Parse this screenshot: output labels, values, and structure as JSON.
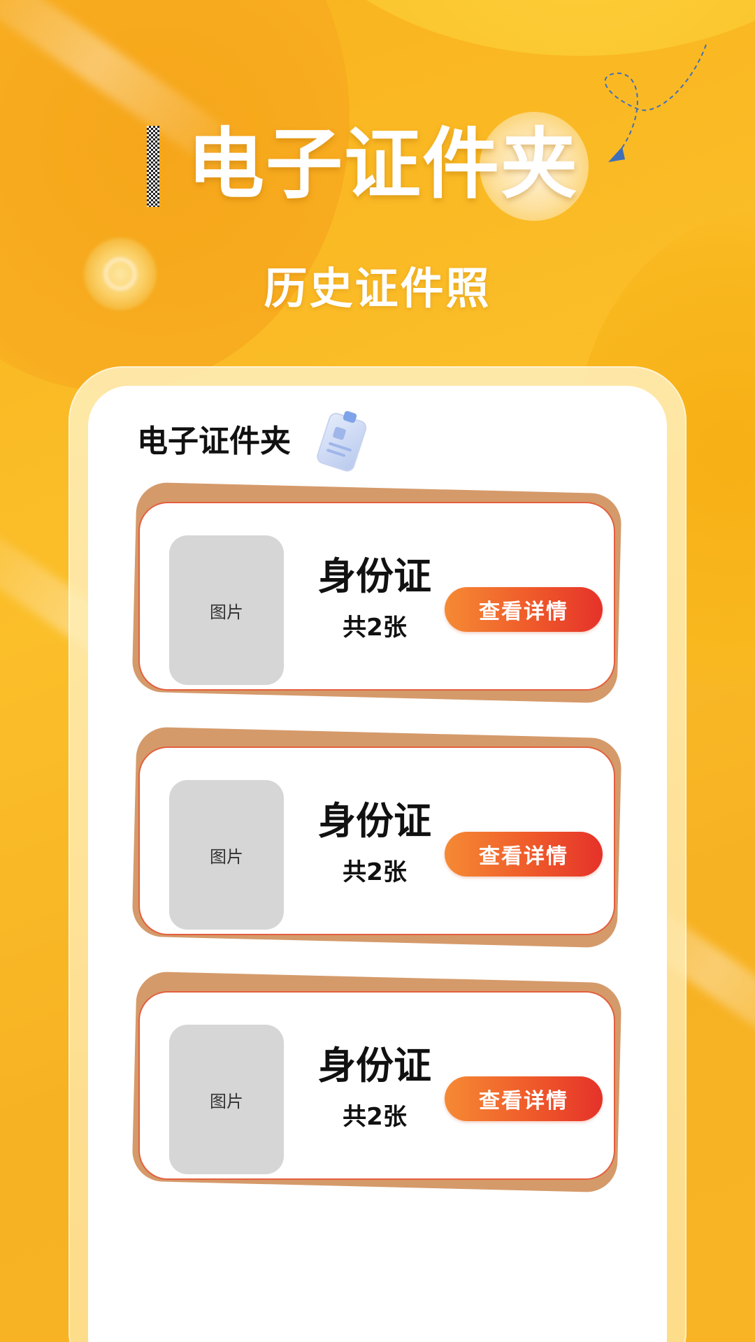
{
  "header": {
    "title": "电子证件夹",
    "subtitle": "历史证件照"
  },
  "panel": {
    "title": "电子证件夹",
    "title_icon": "id-card-icon"
  },
  "documents": [
    {
      "thumbnail_label": "图片",
      "name": "身份证",
      "count": "共2张",
      "button_label": "查看详情"
    },
    {
      "thumbnail_label": "图片",
      "name": "身份证",
      "count": "共2张",
      "button_label": "查看详情"
    },
    {
      "thumbnail_label": "图片",
      "name": "身份证",
      "count": "共2张",
      "button_label": "查看详情"
    }
  ],
  "colors": {
    "background": "#f9b31d",
    "panel": "#ffffff",
    "button_start": "#f58a34",
    "button_end": "#e5322a",
    "card_border": "#e35f3e",
    "card_back": "#d59a6a",
    "thumbnail": "#d6d6d6"
  }
}
